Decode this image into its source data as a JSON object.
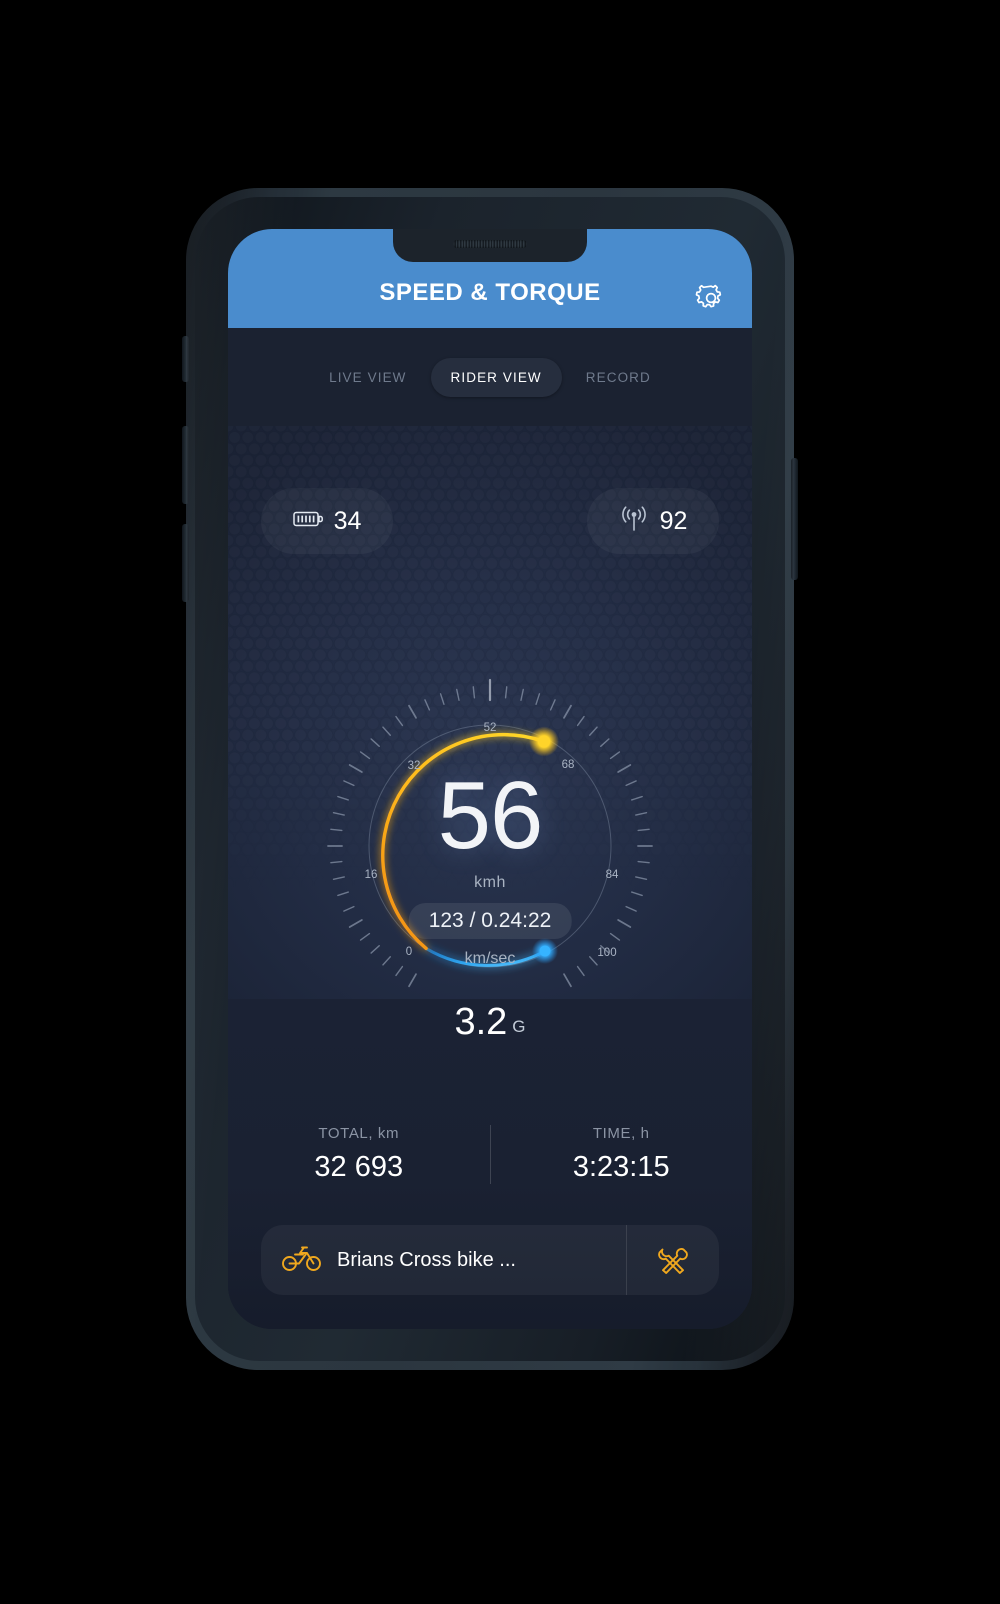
{
  "header": {
    "title": "SPEED & TORQUE",
    "settings_icon": "gear-icon"
  },
  "tabs": [
    {
      "label": "LIVE VIEW",
      "active": false
    },
    {
      "label": "RIDER VIEW",
      "active": true
    },
    {
      "label": "RECORD",
      "active": false
    }
  ],
  "status": {
    "battery": {
      "icon": "battery-icon",
      "value": "34"
    },
    "signal": {
      "icon": "signal-broadcast-icon",
      "value": "92"
    }
  },
  "gauge": {
    "speed": "56",
    "speed_unit": "kmh",
    "sub_value": "123 / 0.24:22",
    "sub_unit": "km/sec",
    "g_value": "3.2",
    "g_unit": "G"
  },
  "totals": [
    {
      "label": "TOTAL, km",
      "value": "32 693"
    },
    {
      "label": "TIME, h",
      "value": "3:23:15"
    }
  ],
  "bike": {
    "icon": "motorcycle-icon",
    "name": "Brians Cross bike ...",
    "tools_icon": "wrench-screwdriver-icon"
  },
  "colors": {
    "header_blue": "#4a8ccd",
    "speed_arc": "#ffc81e",
    "torque_arc": "#27a9f3",
    "accent_orange": "#f0a81e",
    "panel_dark": "#1b2231"
  },
  "chart_data": {
    "type": "gauge",
    "title": "Speed & Torque gauge",
    "tick_labels": [
      "0",
      "16",
      "32",
      "52",
      "68",
      "84",
      "100"
    ],
    "tick_label_angles_deg": [
      -150,
      -110,
      -66,
      0,
      66,
      110,
      150
    ],
    "scale_min": 0,
    "scale_max": 116,
    "series": [
      {
        "name": "Speed (kmh)",
        "value": 56,
        "unit": "kmh",
        "arc_color": "#ffc81e",
        "arc_start_deg": -152,
        "arc_end_deg": 0
      },
      {
        "name": "Torque (G)",
        "value": 3.2,
        "unit": "G",
        "arc_color": "#27a9f3",
        "arc_start_deg": -152,
        "arc_end_deg": -185
      }
    ],
    "center_readout": "56",
    "secondary_readout": "123 / 0.24:22",
    "major_ticks": 7,
    "minor_ticks": 49,
    "grid": false,
    "legend": "none"
  }
}
